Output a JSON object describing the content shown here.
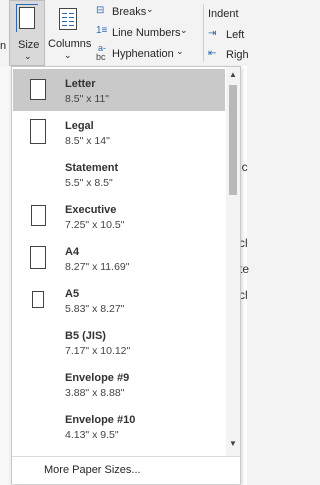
{
  "ribbon": {
    "size_label": "Size",
    "columns_label": "Columns",
    "breaks_label": "Breaks",
    "line_numbers_label": "Line Numbers",
    "hyphenation_label": "Hyphenation",
    "indent_label": "Indent",
    "left_label": "Left",
    "right_label": "Righ",
    "cut_text": "n",
    "chevron": "⌄",
    "hyphen_glyph_top": "a-",
    "hyphen_glyph_bottom": "bc",
    "accent": "#2b6cb0"
  },
  "dropdown": {
    "items": [
      {
        "name": "Letter",
        "dims": "8.5\" x 11\"",
        "selected": true
      },
      {
        "name": "Legal",
        "dims": "8.5\" x 14\"",
        "selected": false
      },
      {
        "name": "Statement",
        "dims": "5.5\" x 8.5\"",
        "selected": false
      },
      {
        "name": "Executive",
        "dims": "7.25\" x 10.5\"",
        "selected": false
      },
      {
        "name": "A4",
        "dims": "8.27\" x 11.69\"",
        "selected": false
      },
      {
        "name": "A5",
        "dims": "5.83\" x 8.27\"",
        "selected": false
      },
      {
        "name": "B5 (JIS)",
        "dims": "7.17\" x 10.12\"",
        "selected": false
      },
      {
        "name": "Envelope #9",
        "dims": "3.88\" x 8.88\"",
        "selected": false
      },
      {
        "name": "Envelope #10",
        "dims": "4.13\" x 9.5\"",
        "selected": false
      }
    ],
    "more_label": "More Paper Sizes...",
    "scroll_up": "▲",
    "scroll_down": "▼",
    "selected_color": "#c9c9c9"
  },
  "document_peek": {
    "chars": [
      "ic",
      "cl",
      "te",
      "cl"
    ]
  }
}
